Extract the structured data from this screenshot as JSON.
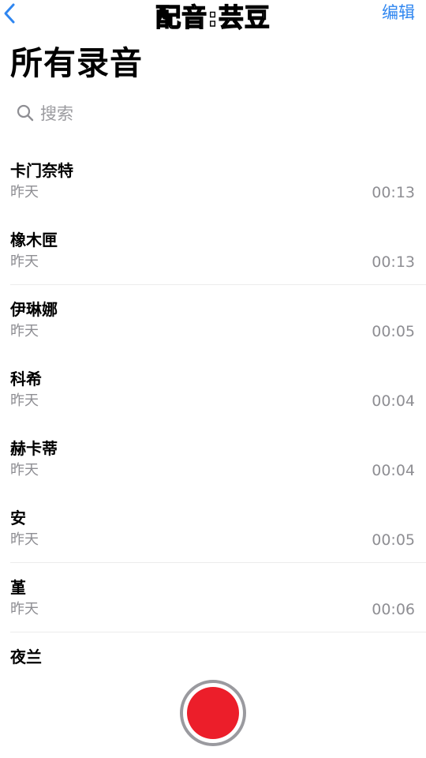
{
  "overlay": {
    "caption": "配音:芸豆"
  },
  "nav": {
    "back_icon": "chevron-left-icon",
    "edit_label": "编辑"
  },
  "title": "所有录音",
  "search": {
    "icon": "search-icon",
    "placeholder": "搜索"
  },
  "recordings": [
    {
      "name": "卡门奈特",
      "date": "昨天",
      "duration": "00:13"
    },
    {
      "name": "橡木匣",
      "date": "昨天",
      "duration": "00:13"
    },
    {
      "name": "伊琳娜",
      "date": "昨天",
      "duration": "00:05"
    },
    {
      "name": "科希",
      "date": "昨天",
      "duration": "00:04"
    },
    {
      "name": "赫卡蒂",
      "date": "昨天",
      "duration": "00:04"
    },
    {
      "name": "安",
      "date": "昨天",
      "duration": "00:05"
    },
    {
      "name": "堇",
      "date": "昨天",
      "duration": "00:06"
    },
    {
      "name": "夜兰",
      "date": "",
      "duration": ""
    }
  ],
  "record": {
    "icon": "record-icon"
  },
  "colors": {
    "accent": "#2f86f0",
    "record_red": "#ec1e2a",
    "secondary_text": "#8e8e93"
  }
}
